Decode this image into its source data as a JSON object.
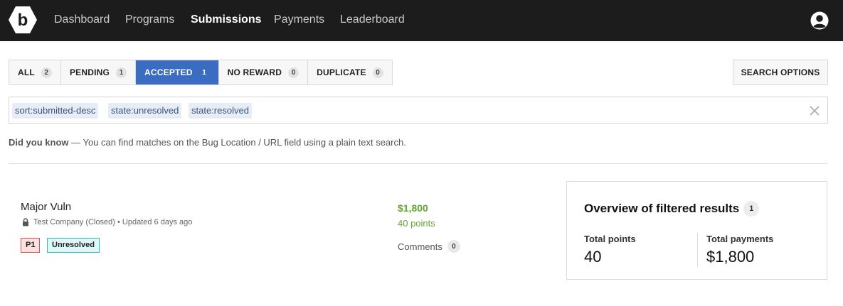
{
  "nav": {
    "items": [
      {
        "label": "Dashboard"
      },
      {
        "label": "Programs"
      },
      {
        "label": "Submissions"
      },
      {
        "label": "Payments"
      },
      {
        "label": "Leaderboard"
      }
    ],
    "active": "Submissions",
    "logo_letter": "b",
    "logo_icon": "brand-logo-hexagon",
    "user_icon": "user-circle-icon"
  },
  "tabs": [
    {
      "label": "ALL",
      "count": "2"
    },
    {
      "label": "PENDING",
      "count": "1"
    },
    {
      "label": "ACCEPTED",
      "count": "1"
    },
    {
      "label": "NO REWARD",
      "count": "0"
    },
    {
      "label": "DUPLICATE",
      "count": "0"
    }
  ],
  "active_tab": "ACCEPTED",
  "search_options_label": "SEARCH OPTIONS",
  "query": {
    "chips": [
      "sort:submitted-desc",
      "state:unresolved",
      "state:resolved"
    ],
    "clear_icon": "close-icon"
  },
  "tip": {
    "heading": "Did you know",
    "text": "— You can find matches on the Bug Location / URL field using a plain text search."
  },
  "submission": {
    "title": "Major Vuln",
    "meta": "Test Company (Closed) • Updated 6 days ago",
    "priority": "P1",
    "state": "Unresolved",
    "reward": "$1,800",
    "points": "40 points",
    "comments_label": "Comments",
    "comments_count": "0"
  },
  "overview": {
    "title": "Overview of filtered results",
    "count": "1",
    "total_points_label": "Total points",
    "total_points": "40",
    "total_payments_label": "Total payments",
    "total_payments": "$1,800"
  },
  "colors": {
    "topbar": "#1c1c1c",
    "active_tab": "#3a6cc1",
    "reward_green": "#5fa830",
    "p1_border": "#d9534f",
    "state_border": "#35b8b8"
  }
}
